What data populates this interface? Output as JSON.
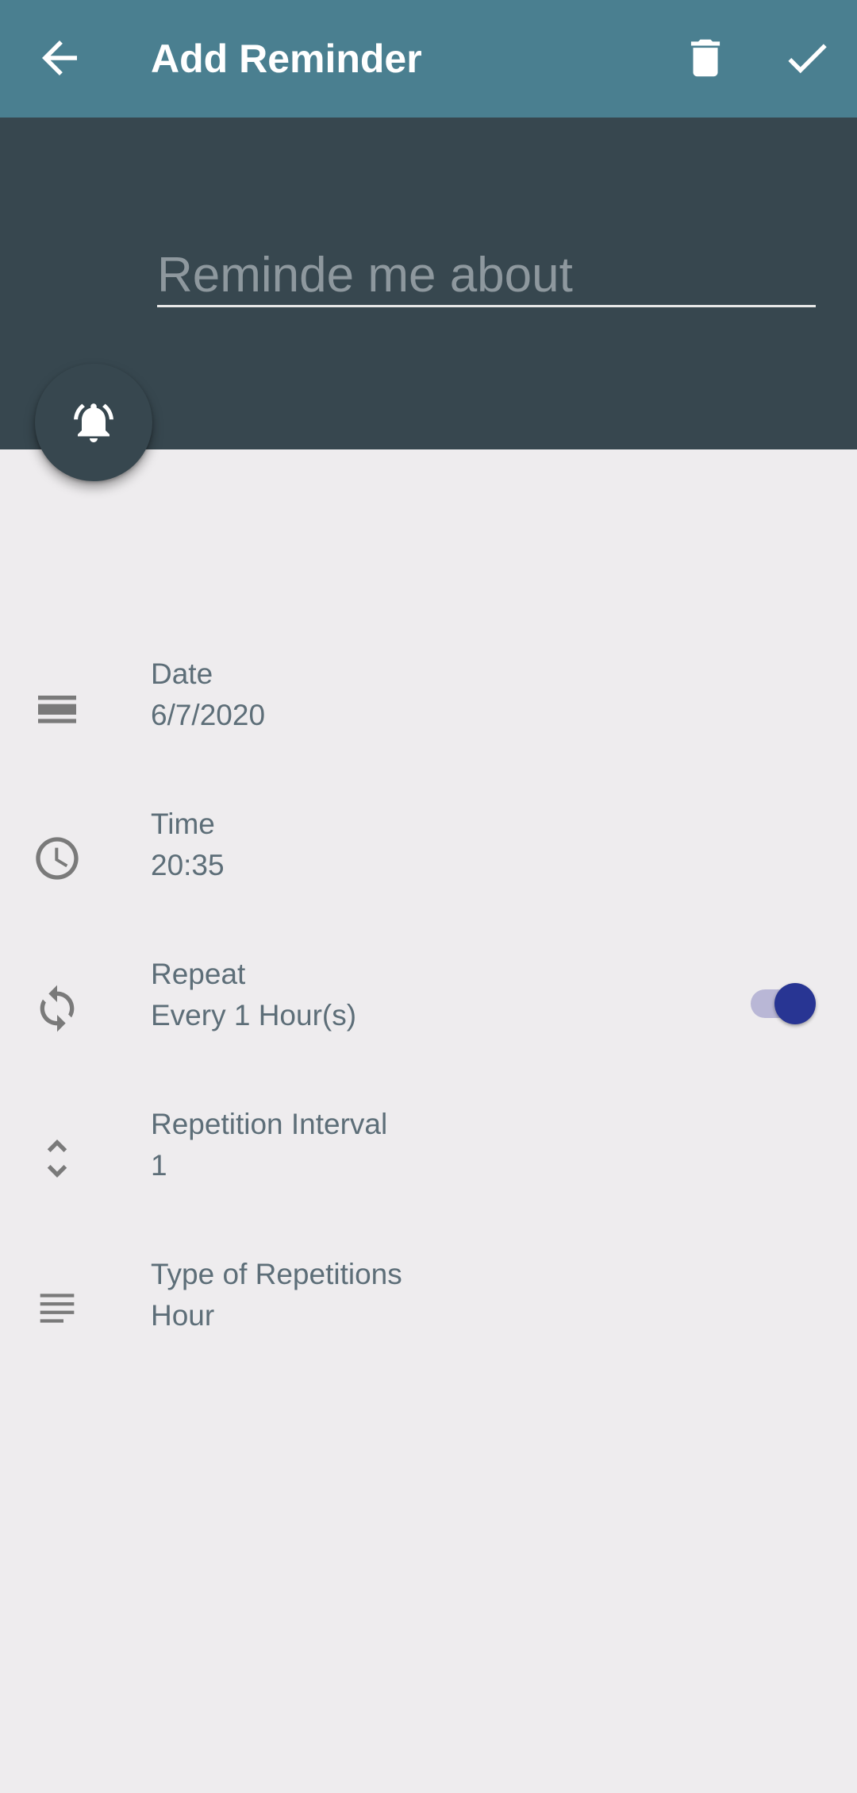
{
  "appbar": {
    "title": "Add Reminder",
    "back_icon": "arrow-left-icon",
    "delete_icon": "trash-icon",
    "save_icon": "check-icon",
    "background": "#4a7f90"
  },
  "header": {
    "input_placeholder": "Reminde me about",
    "input_value": "",
    "background": "#37474f"
  },
  "fab": {
    "icon": "bell-ringing-icon"
  },
  "rows": [
    {
      "icon": "calendar-view-icon",
      "label": "Date",
      "value": "6/7/2020"
    },
    {
      "icon": "clock-icon",
      "label": "Time",
      "value": "20:35"
    },
    {
      "icon": "repeat-icon",
      "label": "Repeat",
      "value": "Every 1 Hour(s)",
      "toggle_on": true
    },
    {
      "icon": "unfold-icon",
      "label": "Repetition Interval",
      "value": "1"
    },
    {
      "icon": "lines-icon",
      "label": "Type of Repetitions",
      "value": "Hour"
    }
  ],
  "colors": {
    "accent": "#283593",
    "text_secondary": "#5d6e78",
    "background": "#eeecee"
  }
}
